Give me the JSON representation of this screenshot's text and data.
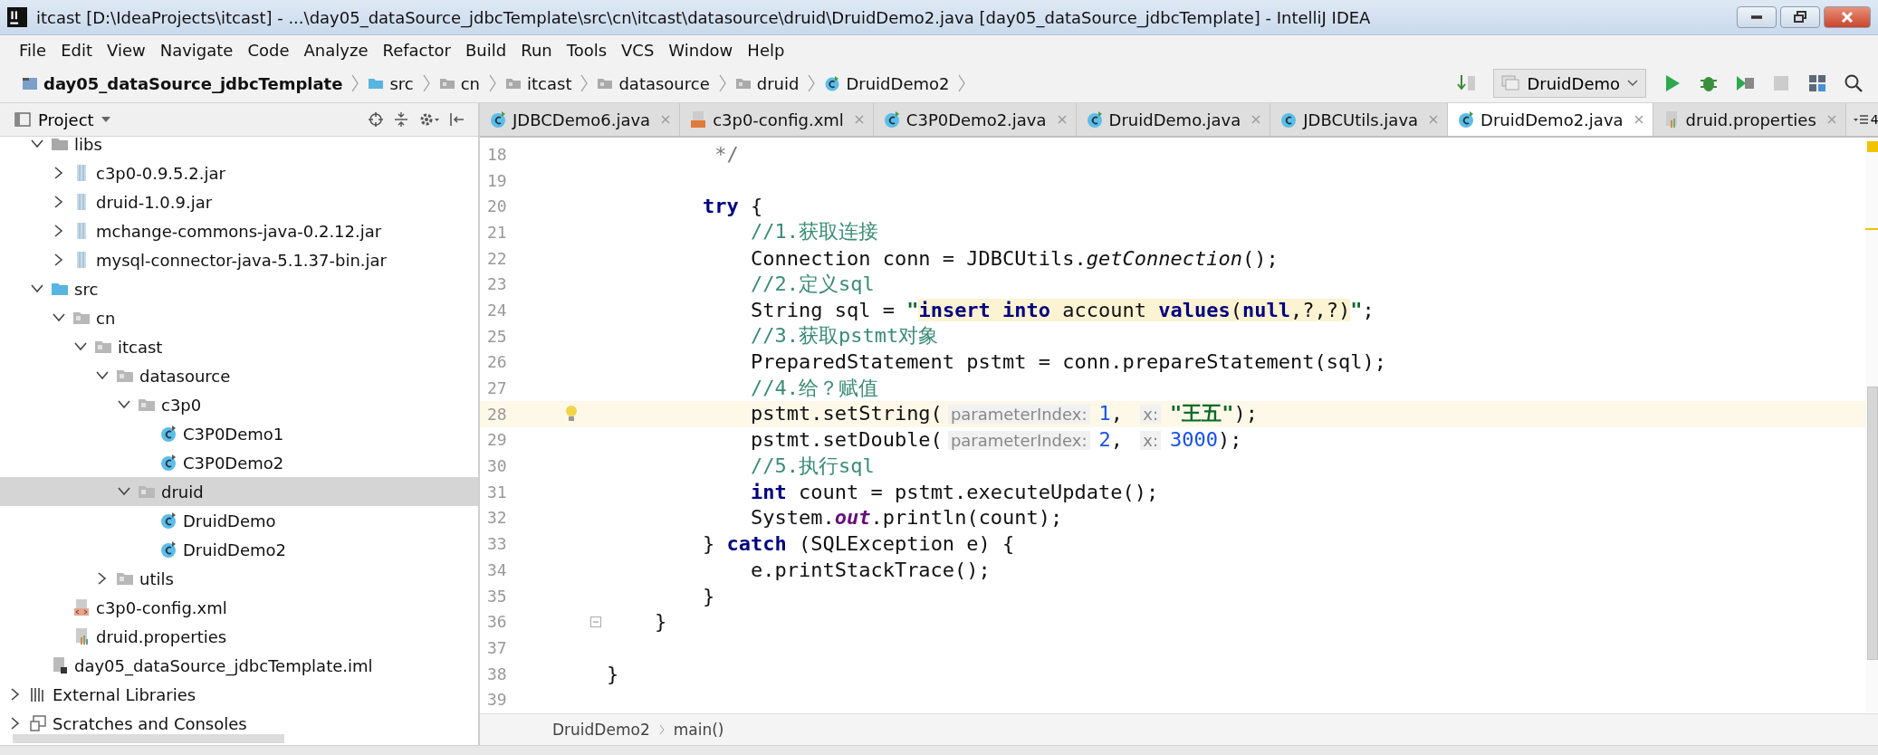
{
  "window": {
    "title": "itcast [D:\\IdeaProjects\\itcast] - ...\\day05_dataSource_jdbcTemplate\\src\\cn\\itcast\\datasource\\druid\\DruidDemo2.java [day05_dataSource_jdbcTemplate] - IntelliJ IDEA"
  },
  "menu": [
    "File",
    "Edit",
    "View",
    "Navigate",
    "Code",
    "Analyze",
    "Refactor",
    "Build",
    "Run",
    "Tools",
    "VCS",
    "Window",
    "Help"
  ],
  "nav_bar": {
    "crumbs": [
      {
        "label": "day05_dataSource_jdbcTemplate",
        "kind": "module"
      },
      {
        "label": "src",
        "kind": "source"
      },
      {
        "label": "cn",
        "kind": "package"
      },
      {
        "label": "itcast",
        "kind": "package"
      },
      {
        "label": "datasource",
        "kind": "package"
      },
      {
        "label": "druid",
        "kind": "package"
      },
      {
        "label": "DruidDemo2",
        "kind": "class"
      }
    ],
    "run_config": "DruidDemo"
  },
  "project_panel": {
    "title": "Project",
    "tree_continued": [
      {
        "label": "libs",
        "kind": "folder",
        "expanded": true,
        "selected": false,
        "children": [
          {
            "label": "c3p0-0.9.5.2.jar",
            "kind": "jar",
            "expanded": false,
            "selected": false
          },
          {
            "label": "druid-1.0.9.jar",
            "kind": "jar",
            "expanded": false,
            "selected": false
          },
          {
            "label": "mchange-commons-java-0.2.12.jar",
            "kind": "jar",
            "expanded": false,
            "selected": false
          },
          {
            "label": "mysql-connector-java-5.1.37-bin.jar",
            "kind": "jar",
            "expanded": false,
            "selected": false
          }
        ]
      },
      {
        "label": "src",
        "kind": "source",
        "expanded": true,
        "selected": false,
        "children": [
          {
            "label": "cn",
            "kind": "package",
            "expanded": true,
            "selected": false,
            "children": [
              {
                "label": "itcast",
                "kind": "package",
                "expanded": true,
                "selected": false,
                "children": [
                  {
                    "label": "datasource",
                    "kind": "package",
                    "expanded": true,
                    "selected": false,
                    "children": [
                      {
                        "label": "c3p0",
                        "kind": "package",
                        "expanded": true,
                        "selected": false,
                        "children": [
                          {
                            "label": "C3P0Demo1",
                            "kind": "class",
                            "selected": false
                          },
                          {
                            "label": "C3P0Demo2",
                            "kind": "class",
                            "selected": false
                          }
                        ]
                      },
                      {
                        "label": "druid",
                        "kind": "package",
                        "expanded": true,
                        "selected": true,
                        "children": [
                          {
                            "label": "DruidDemo",
                            "kind": "class",
                            "selected": false
                          },
                          {
                            "label": "DruidDemo2",
                            "kind": "class",
                            "selected": false
                          }
                        ]
                      }
                    ]
                  },
                  {
                    "label": "utils",
                    "kind": "package",
                    "expanded": false,
                    "selected": false
                  }
                ]
              }
            ]
          },
          {
            "label": "c3p0-config.xml",
            "kind": "xml",
            "selected": false
          },
          {
            "label": "druid.properties",
            "kind": "properties",
            "selected": false
          }
        ]
      },
      {
        "label": "day05_dataSource_jdbcTemplate.iml",
        "kind": "iml",
        "selected": false
      }
    ],
    "tree": [
      {
        "label": "External Libraries",
        "kind": "libraries",
        "expanded": false,
        "selected": false
      },
      {
        "label": "Scratches and Consoles",
        "kind": "scratches",
        "expanded": false,
        "selected": false
      }
    ]
  },
  "tabs": [
    {
      "label": "JDBCDemo6.java",
      "kind": "class",
      "selected": false
    },
    {
      "label": "c3p0-config.xml",
      "kind": "xml",
      "selected": false
    },
    {
      "label": "C3P0Demo2.java",
      "kind": "class",
      "selected": false
    },
    {
      "label": "DruidDemo.java",
      "kind": "class",
      "selected": false
    },
    {
      "label": "JDBCUtils.java",
      "kind": "plain-class",
      "selected": false
    },
    {
      "label": "DruidDemo2.java",
      "kind": "class",
      "selected": true
    },
    {
      "label": "druid.properties",
      "kind": "properties",
      "selected": false
    }
  ],
  "hidden_tabs": "4",
  "editor": {
    "lines": [
      {
        "number": "18",
        "current": false,
        "tokens": [
          {
            "kind": "doc",
            "text": "         */"
          }
        ]
      },
      {
        "number": "19",
        "current": false
      },
      {
        "number": "20",
        "current": false,
        "tokens": [
          {
            "kind": "keyword",
            "text": "        try"
          },
          {
            "kind": "plain",
            "text": " {"
          }
        ]
      },
      {
        "number": "21",
        "current": false,
        "tokens": [
          {
            "kind": "comment",
            "text": "            //1.获取连接"
          }
        ]
      },
      {
        "number": "22",
        "current": false,
        "tokens": [
          {
            "kind": "plain",
            "text": "            Connection conn = JDBCUtils."
          },
          {
            "kind": "static",
            "text": "getConnection"
          },
          {
            "kind": "plain",
            "text": "();"
          }
        ]
      },
      {
        "number": "23",
        "current": false,
        "tokens": [
          {
            "kind": "comment",
            "text": "            //2.定义sql"
          }
        ]
      },
      {
        "number": "24",
        "current": false,
        "tokens": [
          {
            "kind": "plain",
            "text": "            String sql = "
          },
          {
            "kind": "string",
            "text": "\""
          },
          {
            "kind": "sql-keyword",
            "text": "insert into"
          },
          {
            "kind": "sql",
            "text": " account "
          },
          {
            "kind": "sql-keyword",
            "text": "values"
          },
          {
            "kind": "sql",
            "text": "("
          },
          {
            "kind": "sql-keyword",
            "text": "null"
          },
          {
            "kind": "sql",
            "text": ",?,?)"
          },
          {
            "kind": "string",
            "text": "\""
          },
          {
            "kind": "plain",
            "text": ";"
          }
        ]
      },
      {
        "number": "25",
        "current": false,
        "tokens": [
          {
            "kind": "comment",
            "text": "            //3.获取pstmt对象"
          }
        ]
      },
      {
        "number": "26",
        "current": false,
        "tokens": [
          {
            "kind": "plain",
            "text": "            PreparedStatement pstmt = conn.prepareStatement(sql);"
          }
        ]
      },
      {
        "number": "27",
        "current": false,
        "tokens": [
          {
            "kind": "comment",
            "text": "            //4.给？赋值"
          }
        ]
      },
      {
        "number": "28",
        "current": true,
        "bulb": true,
        "tokens": [
          {
            "kind": "plain",
            "text": "            pstmt.setString("
          },
          {
            "kind": "hint",
            "text": "parameterIndex:"
          },
          {
            "kind": "number",
            "text": "1"
          },
          {
            "kind": "plain",
            "text": ", "
          },
          {
            "kind": "hint",
            "text": "x:"
          },
          {
            "kind": "string",
            "text": "\"王五\""
          },
          {
            "kind": "plain",
            "text": ");"
          }
        ]
      },
      {
        "number": "29",
        "current": false,
        "tokens": [
          {
            "kind": "plain",
            "text": "            pstmt.setDouble("
          },
          {
            "kind": "hint",
            "text": "parameterIndex:"
          },
          {
            "kind": "number",
            "text": "2"
          },
          {
            "kind": "plain",
            "text": ", "
          },
          {
            "kind": "hint",
            "text": "x:"
          },
          {
            "kind": "number",
            "text": "3000"
          },
          {
            "kind": "plain",
            "text": ");"
          }
        ]
      },
      {
        "number": "30",
        "current": false,
        "tokens": [
          {
            "kind": "comment",
            "text": "            //5.执行sql"
          }
        ]
      },
      {
        "number": "31",
        "current": false,
        "tokens": [
          {
            "kind": "keyword",
            "text": "            int"
          },
          {
            "kind": "plain",
            "text": " count = pstmt.executeUpdate();"
          }
        ]
      },
      {
        "number": "32",
        "current": false,
        "tokens": [
          {
            "kind": "plain",
            "text": "            System."
          },
          {
            "kind": "field",
            "text": "out"
          },
          {
            "kind": "plain",
            "text": ".println(count);"
          }
        ]
      },
      {
        "number": "33",
        "current": false,
        "tokens": [
          {
            "kind": "plain",
            "text": "        } "
          },
          {
            "kind": "keyword",
            "text": "catch"
          },
          {
            "kind": "plain",
            "text": " (SQLException e) {"
          }
        ]
      },
      {
        "number": "34",
        "current": false,
        "tokens": [
          {
            "kind": "plain",
            "text": "            e.printStackTrace();"
          }
        ]
      },
      {
        "number": "35",
        "current": false,
        "tokens": [
          {
            "kind": "plain",
            "text": "        }"
          }
        ]
      },
      {
        "number": "36",
        "current": false,
        "fold": true,
        "tokens": [
          {
            "kind": "plain",
            "text": "    }"
          }
        ]
      },
      {
        "number": "37",
        "current": false
      },
      {
        "number": "38",
        "current": false,
        "tokens": [
          {
            "kind": "plain",
            "text": "}"
          }
        ]
      },
      {
        "number": "39",
        "current": false
      }
    ],
    "breadcrumbs": [
      "DruidDemo2",
      "main()"
    ]
  }
}
